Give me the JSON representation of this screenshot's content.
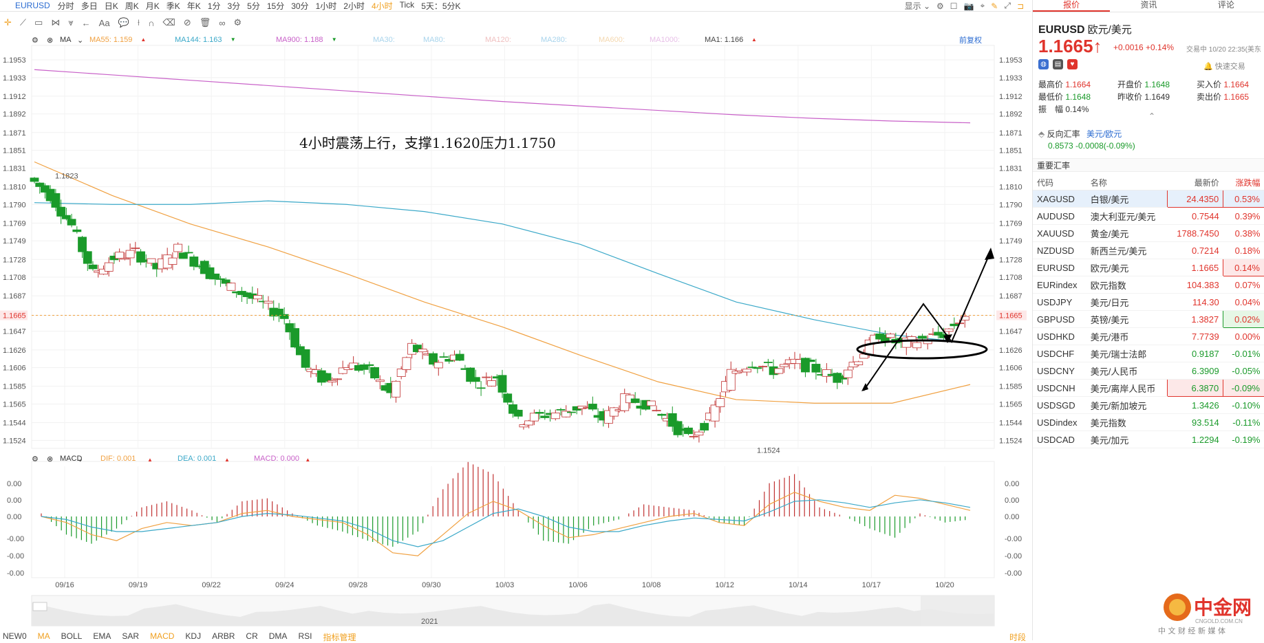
{
  "topbar": {
    "symbol": "EURUSD",
    "periods": [
      "分时",
      "多日",
      "日K",
      "周K",
      "月K",
      "季K",
      "年K",
      "1分",
      "3分",
      "5分",
      "15分",
      "30分",
      "1小时",
      "2小时",
      "4小时",
      "Tick",
      "5天：5分K"
    ],
    "active_period": "4小时",
    "display_label": "显示"
  },
  "toolbar": {
    "text_tool": "Aa"
  },
  "main_legend": {
    "ma_label": "MA",
    "items": [
      {
        "text": "MA55: 1.159",
        "color": "#f0a040"
      },
      {
        "text": "MA144: 1.163",
        "color": "#3aa8c8"
      },
      {
        "text": "MA900: 1.188",
        "color": "#c860c8"
      },
      {
        "text": "MA30:",
        "color": "#a8d4ec"
      },
      {
        "text": "MA80:",
        "color": "#a8d4ec"
      },
      {
        "text": "MA120:",
        "color": "#f0c0c0"
      },
      {
        "text": "MA280:",
        "color": "#a8d4ec"
      },
      {
        "text": "MA600:",
        "color": "#f4d8b0"
      },
      {
        "text": "MA1000:",
        "color": "#e8c0e8"
      },
      {
        "text": "MA1: 1.166",
        "color": "#444444"
      }
    ],
    "adjust_label": "前复权"
  },
  "macd_legend": {
    "label": "MACD",
    "items": [
      {
        "text": "DIF: 0.001",
        "color": "#f0a040"
      },
      {
        "text": "DEA: 0.001",
        "color": "#3aa8c8"
      },
      {
        "text": "MACD: 0.000",
        "color": "#c860c8"
      }
    ]
  },
  "chart_data": {
    "type": "candlestick",
    "annotation": "4小时震荡上行，支撑1.1620压力1.1750",
    "current_price": "1.1665",
    "price_ticks": [
      "1.1953",
      "1.1933",
      "1.1912",
      "1.1892",
      "1.1871",
      "1.1851",
      "1.1831",
      "1.1810",
      "1.1790",
      "1.1769",
      "1.1749",
      "1.1728",
      "1.1708",
      "1.1687",
      "1.1665",
      "1.1647",
      "1.1626",
      "1.1606",
      "1.1585",
      "1.1565",
      "1.1544",
      "1.1524"
    ],
    "y_range": [
      1.1515,
      1.196
    ],
    "x_labels": [
      "09/16",
      "09/19",
      "09/22",
      "09/24",
      "09/28",
      "09/30",
      "10/03",
      "10/06",
      "10/08",
      "10/12",
      "10/14",
      "10/17",
      "10/20"
    ],
    "high_label": "1.1823",
    "low_label": "1.1524",
    "navigator_label": "2021",
    "ma900": [
      1.1942,
      1.1936,
      1.193,
      1.1924,
      1.1918,
      1.1912,
      1.1906,
      1.1901,
      1.1896,
      1.1891,
      1.1887,
      1.1884,
      1.1882
    ],
    "ma55": [
      1.1838,
      1.18,
      1.1768,
      1.1742,
      1.1712,
      1.168,
      1.1652,
      1.162,
      1.159,
      1.157,
      1.1566,
      1.1566,
      1.1587
    ],
    "ma144": [
      1.1792,
      1.179,
      1.179,
      1.1794,
      1.179,
      1.1782,
      1.1768,
      1.1745,
      1.1712,
      1.168,
      1.166,
      1.1643,
      1.1634
    ],
    "close": [
      1.182,
      1.18,
      1.1766,
      1.1712,
      1.173,
      1.1736,
      1.1718,
      1.174,
      1.1722,
      1.1702,
      1.169,
      1.1678,
      1.1662,
      1.1606,
      1.159,
      1.161,
      1.1602,
      1.1576,
      1.163,
      1.1612,
      1.162,
      1.1588,
      1.1596,
      1.1545,
      1.1552,
      1.1556,
      1.1562,
      1.1548,
      1.157,
      1.1566,
      1.1548,
      1.1526,
      1.1548,
      1.16,
      1.1612,
      1.1603,
      1.1612,
      1.1604,
      1.1594,
      1.1618,
      1.1644,
      1.1632,
      1.1638,
      1.1644,
      1.1665
    ],
    "macd_ticks": [
      "0.00",
      "0.00",
      "0.00",
      "-0.00",
      "-0.00",
      "-0.00"
    ],
    "dif": [
      0.0,
      -0.4,
      -1.2,
      -1.6,
      -0.8,
      -0.4,
      -0.6,
      -0.4,
      0.2,
      0.4,
      0.0,
      -0.2,
      -0.4,
      -1.2,
      -2.4,
      -2.6,
      -1.2,
      0.2,
      1.0,
      0.4,
      -0.6,
      -1.4,
      -1.2,
      -0.8,
      -0.4,
      0.0,
      0.2,
      -0.4,
      -0.6,
      0.8,
      1.6,
      1.0,
      0.6,
      0.4,
      1.4,
      1.2,
      0.8,
      0.4
    ],
    "dea": [
      0.0,
      -0.2,
      -0.7,
      -1.0,
      -1.0,
      -0.8,
      -0.6,
      -0.4,
      0.0,
      0.2,
      0.1,
      -0.1,
      -0.3,
      -0.8,
      -1.6,
      -2.0,
      -1.6,
      -0.7,
      0.2,
      0.5,
      0.0,
      -0.7,
      -1.0,
      -1.0,
      -0.6,
      -0.3,
      -0.1,
      -0.2,
      -0.3,
      0.3,
      1.0,
      1.1,
      0.9,
      0.6,
      0.9,
      1.1,
      0.9,
      0.6
    ],
    "macd_hist": [
      0.2,
      -1.2,
      -1.8,
      -0.8,
      0.6,
      1.0,
      0.4,
      -0.4,
      1.0,
      1.2,
      0.2,
      -0.6,
      -1.0,
      -1.6,
      -2.0,
      -1.0,
      1.8,
      3.6,
      2.8,
      0.4,
      -1.6,
      -1.8,
      -0.6,
      -0.2,
      0.8,
      0.6,
      0.4,
      -0.4,
      -0.6,
      2.2,
      2.8,
      0.6,
      0.0,
      -0.8,
      -1.4,
      0.2,
      -0.4,
      -0.2
    ]
  },
  "bottom_tabs": [
    "NEW0",
    "MA",
    "BOLL",
    "EMA",
    "SAR",
    "MACD",
    "KDJ",
    "ARBR",
    "CR",
    "DMA",
    "RSI",
    "指标管理"
  ],
  "bottom_active": [
    "MA",
    "MACD"
  ],
  "bottom_right_label": "时段",
  "right": {
    "tabs": [
      "报价",
      "资讯",
      "评论"
    ],
    "active_tab": "报价",
    "symbol": "EURUSD",
    "name": "欧元/美元",
    "price": "1.1665↑",
    "change": "+0.0016 +0.14%",
    "trade_time": "交易中 10/20 22:35(美东",
    "fast_trade": "快速交易",
    "stats": {
      "high_label": "最高价",
      "high": "1.1664",
      "open_label": "开盘价",
      "open": "1.1648",
      "bid_label": "买入价",
      "bid": "1.1664",
      "low_label": "最低价",
      "low": "1.1648",
      "prev_label": "昨收价",
      "prev": "1.1649",
      "ask_label": "卖出价",
      "ask": "1.1665",
      "amp_label": "振　幅",
      "amp": "0.14%"
    },
    "reverse": {
      "label": "反向汇率",
      "pair": "美元/欧元",
      "value": "0.8573",
      "change": "-0.0008(-0.09%)"
    },
    "section_title": "重要汇率",
    "columns": [
      "代码",
      "名称",
      "最新价",
      "涨跌幅"
    ],
    "rows": [
      {
        "code": "XAGUSD",
        "name": "白银/美元",
        "price": "24.4350",
        "pct": "0.53%",
        "dir": "up",
        "box": true
      },
      {
        "code": "AUDUSD",
        "name": "澳大利亚元/美元",
        "price": "0.7544",
        "pct": "0.39%",
        "dir": "up",
        "box": false
      },
      {
        "code": "XAUUSD",
        "name": "黄金/美元",
        "price": "1788.7450",
        "pct": "0.38%",
        "dir": "up",
        "box": false
      },
      {
        "code": "NZDUSD",
        "name": "新西兰元/美元",
        "price": "0.7214",
        "pct": "0.18%",
        "dir": "up",
        "box": false
      },
      {
        "code": "EURUSD",
        "name": "欧元/美元",
        "price": "1.1665",
        "pct": "0.14%",
        "dir": "up",
        "box": true
      },
      {
        "code": "EURindex",
        "name": "欧元指数",
        "price": "104.383",
        "pct": "0.07%",
        "dir": "up",
        "box": false
      },
      {
        "code": "USDJPY",
        "name": "美元/日元",
        "price": "114.30",
        "pct": "0.04%",
        "dir": "up",
        "box": false
      },
      {
        "code": "GBPUSD",
        "name": "英镑/美元",
        "price": "1.3827",
        "pct": "0.02%",
        "dir": "up",
        "box": true
      },
      {
        "code": "USDHKD",
        "name": "美元/港币",
        "price": "7.7739",
        "pct": "0.00%",
        "dir": "up",
        "box": false
      },
      {
        "code": "USDCHF",
        "name": "美元/瑞士法郎",
        "price": "0.9187",
        "pct": "-0.01%",
        "dir": "down",
        "box": false
      },
      {
        "code": "USDCNY",
        "name": "美元/人民币",
        "price": "6.3909",
        "pct": "-0.05%",
        "dir": "down",
        "box": false
      },
      {
        "code": "USDCNH",
        "name": "美元/离岸人民币",
        "price": "6.3870",
        "pct": "-0.09%",
        "dir": "down",
        "box": true
      },
      {
        "code": "USDSGD",
        "name": "美元/新加坡元",
        "price": "1.3426",
        "pct": "-0.10%",
        "dir": "down",
        "box": false
      },
      {
        "code": "USDindex",
        "name": "美元指数",
        "price": "93.514",
        "pct": "-0.11%",
        "dir": "down",
        "box": false
      },
      {
        "code": "USDCAD",
        "name": "美元/加元",
        "price": "1.2294",
        "pct": "-0.19%",
        "dir": "down",
        "box": false
      }
    ]
  },
  "logo": {
    "name": "中金网",
    "domain": "CNGOLD.COM.CN",
    "slogan": "中 文 财 经 新 媒 体"
  }
}
